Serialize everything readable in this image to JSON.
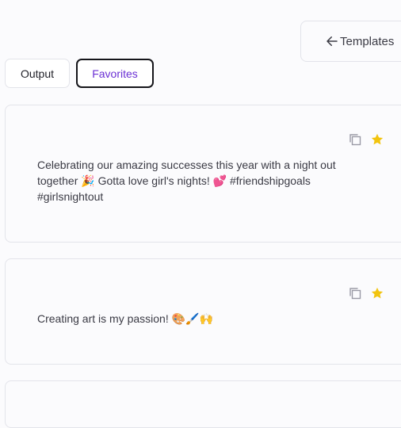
{
  "header": {
    "templates_label": "Templates",
    "back_icon": "arrow-left-icon"
  },
  "tabs": [
    {
      "label": "Output",
      "active": false
    },
    {
      "label": "Favorites",
      "active": true
    }
  ],
  "colors": {
    "accent": "#6a2fd4",
    "star": "#f2c40f",
    "border": "#e3e4ea"
  },
  "results": [
    {
      "text": "Celebrating our amazing successes this year with a night out together 🎉 Gotta love girl's nights! 💕 #friendshipgoals #girlsnightout",
      "favorited": true
    },
    {
      "text": "Creating art is my passion! 🎨🖌️🙌",
      "favorited": true
    }
  ]
}
